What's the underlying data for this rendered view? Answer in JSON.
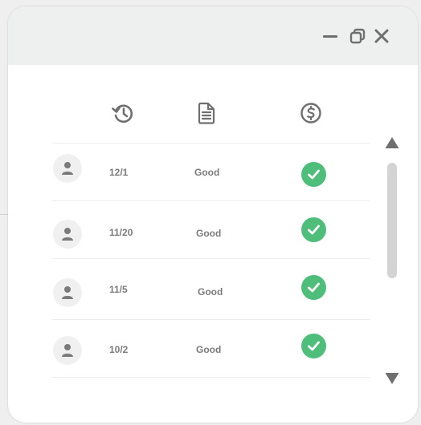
{
  "icons": {
    "minimize": "minimize-icon",
    "restore": "restore-icon",
    "close": "close-icon",
    "history": "history-icon",
    "document": "document-icon",
    "money": "dollar-icon",
    "avatar": "person-icon",
    "check": "check-circle-icon",
    "scroll_up": "triangle-up-icon",
    "scroll_down": "triangle-down-icon"
  },
  "colors": {
    "titlebar": "#eef0ef",
    "icon_gray": "#6f6f6f",
    "text_gray": "#7b7b7b",
    "success_green": "#4fbe7a",
    "avatar_bg": "#f0f0f0",
    "scrollbar": "#d3d3d3"
  },
  "rows": [
    {
      "date": "12/1",
      "status": "Good",
      "paid": true
    },
    {
      "date": "11/20",
      "status": "Good",
      "paid": true
    },
    {
      "date": "11/5",
      "status": "Good",
      "paid": true
    },
    {
      "date": "10/2",
      "status": "Good",
      "paid": true
    }
  ]
}
